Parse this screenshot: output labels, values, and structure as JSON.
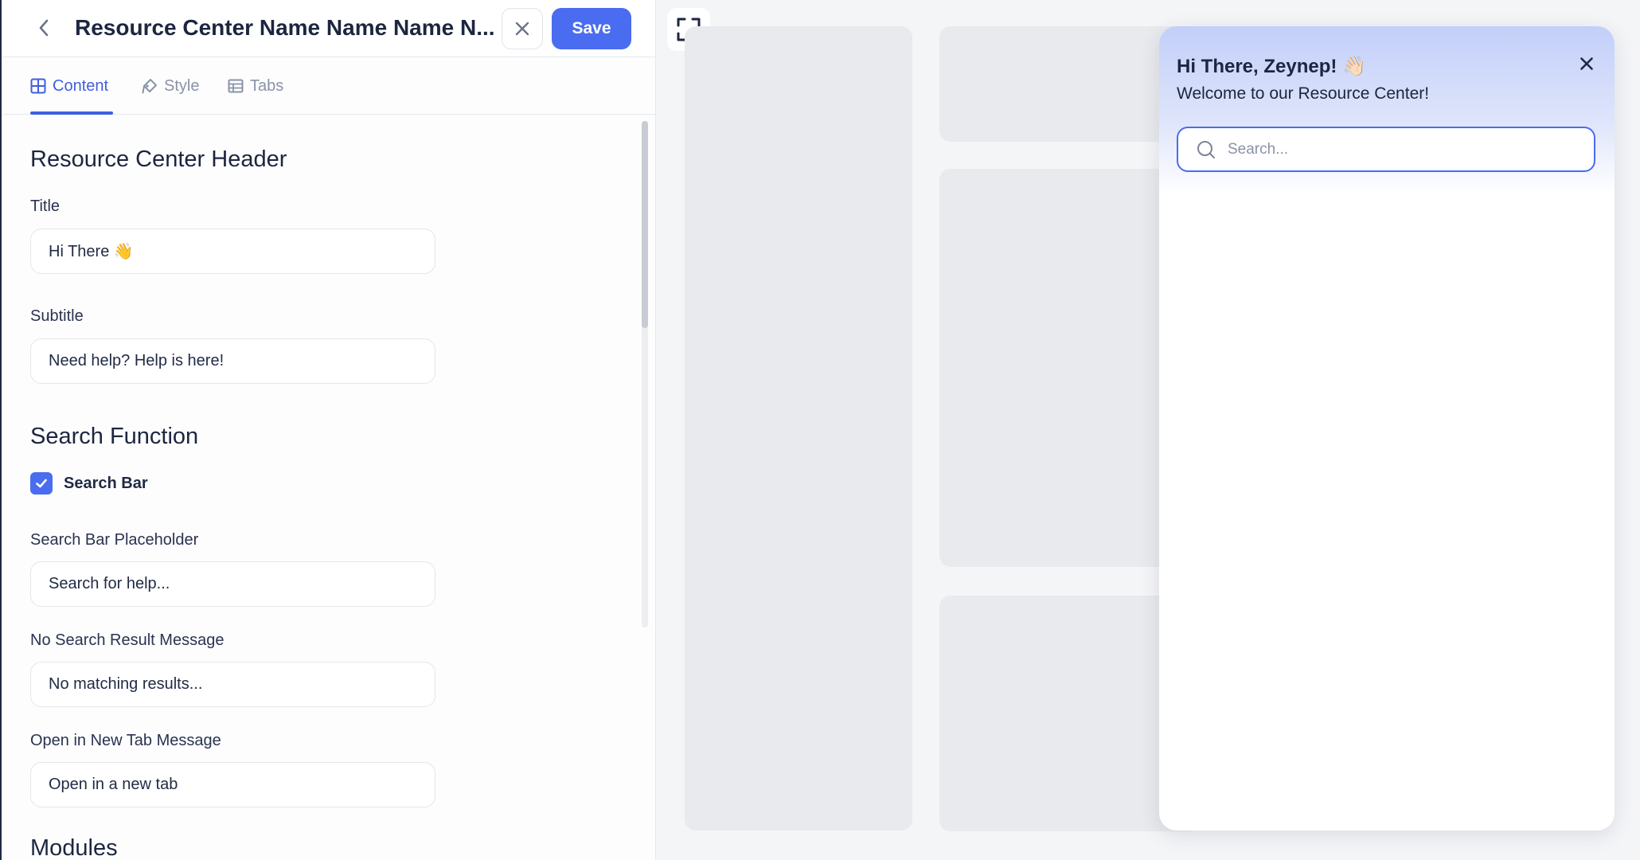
{
  "header": {
    "title": "Resource Center Name Name Name N...",
    "save_label": "Save"
  },
  "tabs": [
    {
      "label": "Content",
      "icon": "layout-icon",
      "active": true
    },
    {
      "label": "Style",
      "icon": "paint-icon",
      "active": false
    },
    {
      "label": "Tabs",
      "icon": "table-icon",
      "active": false
    }
  ],
  "form": {
    "header_section": "Resource Center Header",
    "title_label": "Title",
    "title_value": "Hi There 👋",
    "subtitle_label": "Subtitle",
    "subtitle_value": "Need help? Help is here!",
    "search_section": "Search Function",
    "search_bar_label": "Search Bar",
    "search_bar_checked": true,
    "placeholder_label": "Search Bar Placeholder",
    "placeholder_value": "Search for help...",
    "no_result_label": "No Search Result Message",
    "no_result_value": "No matching results...",
    "new_tab_label": "Open in New Tab Message",
    "new_tab_value": "Open in a new tab",
    "modules_section": "Modules"
  },
  "preview": {
    "greeting": "Hi There, Zeynep! 👋🏻",
    "welcome": "Welcome to our Resource Center!",
    "search_placeholder": "Search..."
  },
  "colors": {
    "accent": "#4a6cf0",
    "text": "#1c2640",
    "muted": "#8a93a6",
    "placeholder_block": "#e8eaed"
  }
}
